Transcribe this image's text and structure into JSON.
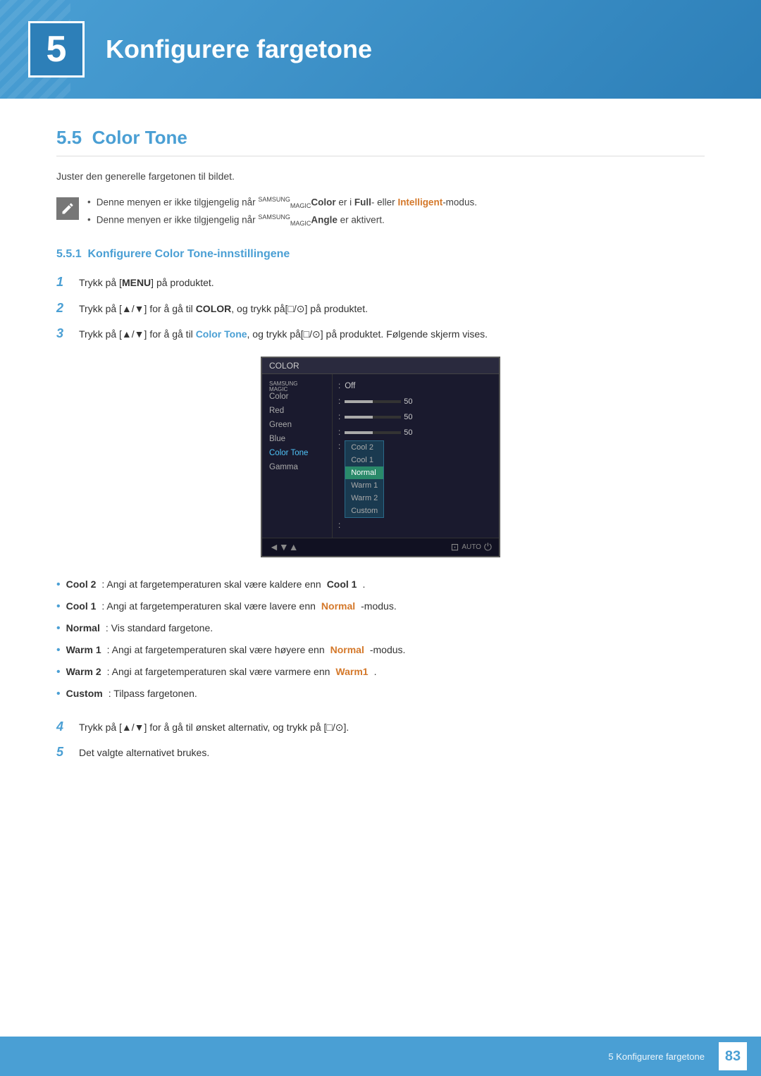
{
  "chapter": {
    "number": "5",
    "title": "Konfigurere fargetone"
  },
  "section": {
    "number": "5.5",
    "title": "Color Tone",
    "description": "Juster den generelle fargetonen til bildet."
  },
  "notes": [
    {
      "text_parts": [
        "Denne menyen er ikke tilgjengelig når ",
        "SAMSUNG MAGIC",
        "Color",
        " er i ",
        "Full",
        "- eller ",
        "Intelligent",
        "-modus."
      ]
    },
    {
      "text_parts": [
        "Denne menyen er ikke tilgjengelig når ",
        "SAMSUNG MAGIC",
        "Angle",
        " er aktivert."
      ]
    }
  ],
  "subsection": {
    "number": "5.5.1",
    "title": "Konfigurere Color Tone-innstillingene"
  },
  "steps": [
    {
      "num": "1",
      "text": "Trykk på [MENU] på produktet."
    },
    {
      "num": "2",
      "text": "Trykk på [▲/▼] for å gå til COLOR, og trykk på[□/⊙] på produktet."
    },
    {
      "num": "3",
      "text": "Trykk på [▲/▼] for å gå til Color Tone, og trykk på[□/⊙] på produktet. Følgende skjerm vises."
    },
    {
      "num": "4",
      "text": "Trykk på [▲/▼] for å gå til ønsket alternativ, og trykk på [□/⊙]."
    },
    {
      "num": "5",
      "text": "Det valgte alternativet brukes."
    }
  ],
  "screen": {
    "title": "COLOR",
    "menu_items": [
      {
        "label": "SAMSUNG MAGIC Color",
        "type": "magic",
        "active": false
      },
      {
        "label": "Red",
        "active": false
      },
      {
        "label": "Green",
        "active": false
      },
      {
        "label": "Blue",
        "active": false
      },
      {
        "label": "Color Tone",
        "active": true
      },
      {
        "label": "Gamma",
        "active": false
      }
    ],
    "values": [
      {
        "type": "text",
        "value": "Off"
      },
      {
        "type": "bar",
        "value": 50
      },
      {
        "type": "bar",
        "value": 50
      },
      {
        "type": "bar",
        "value": 50
      },
      {
        "type": "dropdown",
        "options": [
          "Cool 2",
          "Cool 1",
          "Normal",
          "Warm 1",
          "Warm 2",
          "Custom"
        ],
        "selected": "Normal"
      },
      {
        "type": "empty"
      }
    ]
  },
  "options": [
    {
      "name": "Cool 2",
      "desc": ": Angi at fargetemperaturen skal være kaldere enn ",
      "ref": "Cool 1",
      "after": "."
    },
    {
      "name": "Cool 1",
      "desc": ": Angi at fargetemperaturen skal være lavere enn ",
      "ref": "Normal",
      "after": "-modus."
    },
    {
      "name": "Normal",
      "desc": ": Vis standard fargetone.",
      "ref": "",
      "after": ""
    },
    {
      "name": "Warm 1",
      "desc": ": Angi at fargetemperaturen skal være høyere enn ",
      "ref": "Normal",
      "after": "-modus."
    },
    {
      "name": "Warm 2",
      "desc": ": Angi at fargetemperaturen skal være varmere enn ",
      "ref": "Warm1",
      "after": "."
    },
    {
      "name": "Custom",
      "desc": ": Tilpass fargetonen.",
      "ref": "",
      "after": ""
    }
  ],
  "footer": {
    "chapter_text": "5 Konfigurere fargetone",
    "page_number": "83"
  }
}
